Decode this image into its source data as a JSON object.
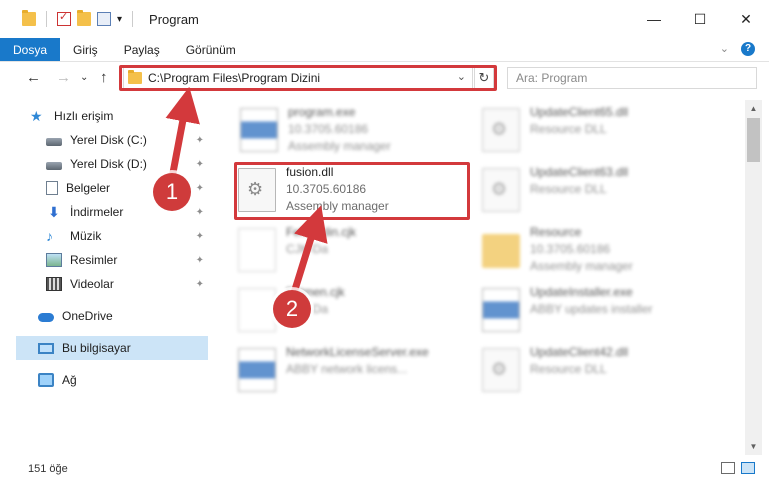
{
  "window": {
    "title": "Program",
    "buttons": {
      "minimize": "—",
      "maximize": "☐",
      "close": "✕"
    }
  },
  "ribbon": {
    "tabs": [
      "Dosya",
      "Giriş",
      "Paylaş",
      "Görünüm"
    ],
    "expand": "⌄",
    "help": "?"
  },
  "nav": {
    "back": "←",
    "forward": "→",
    "recent": "⌄",
    "up": "↑",
    "address": "C:\\Program Files\\Program Dizini",
    "address_chevron": "⌄",
    "refresh": "↻",
    "search_placeholder": "Ara: Program"
  },
  "sidebar": {
    "items": [
      {
        "label": "Hızlı erişim",
        "icon": "star-icon"
      },
      {
        "label": "Yerel Disk (C:)",
        "icon": "drive-icon",
        "pinned": true
      },
      {
        "label": "Yerel Disk (D:)",
        "icon": "drive-icon",
        "pinned": true
      },
      {
        "label": "Belgeler",
        "icon": "document-icon",
        "pinned": true
      },
      {
        "label": "İndirmeler",
        "icon": "download-icon",
        "pinned": true
      },
      {
        "label": "Müzik",
        "icon": "music-icon",
        "pinned": true
      },
      {
        "label": "Resimler",
        "icon": "pictures-icon",
        "pinned": true
      },
      {
        "label": "Videolar",
        "icon": "videos-icon",
        "pinned": true
      },
      {
        "label": "OneDrive",
        "icon": "cloud-icon"
      },
      {
        "label": "Bu bilgisayar",
        "icon": "computer-icon",
        "selected": true
      },
      {
        "label": "Ağ",
        "icon": "network-icon"
      }
    ],
    "pin_glyph": "📌"
  },
  "files": [
    {
      "name": "program.exe",
      "line2": "10.3705.60186",
      "line3": "Assembly manager",
      "icon": "exe-icon",
      "blurred": true
    },
    {
      "name": "UpdateClient65.dll",
      "line2": "Resource DLL",
      "line3": "",
      "icon": "dll-icon",
      "blurred": true
    },
    {
      "name": "fusion.dll",
      "line2": "10.3705.60186",
      "line3": "Assembly manager",
      "icon": "dll-icon",
      "blurred": false
    },
    {
      "name": "UpdateClient63.dll",
      "line2": "Resource DLL",
      "line3": "",
      "icon": "dll-icon",
      "blurred": true
    },
    {
      "name": "Fehlerklin.cjk",
      "line2": "CJK-Da",
      "line3": "",
      "icon": "file-icon",
      "blurred": true
    },
    {
      "name": "Resource",
      "line2": "10.3705.60186",
      "line3": "Assembly manager",
      "icon": "folder-icon",
      "blurred": true
    },
    {
      "name": "Fatmen.cjk",
      "line2": "CJK-Da",
      "line3": "",
      "icon": "file-icon",
      "blurred": true
    },
    {
      "name": "UpdateInstaller.exe",
      "line2": "ABBY updates installer",
      "line3": "",
      "icon": "exe-icon",
      "blurred": true
    },
    {
      "name": "NetworkLicenseServer.exe",
      "line2": "ABBY network licens...",
      "line3": "",
      "icon": "exe-icon",
      "blurred": true
    },
    {
      "name": "UpdateClient42.dll",
      "line2": "Resource DLL",
      "line3": "",
      "icon": "dll-icon",
      "blurred": true
    }
  ],
  "status": {
    "count": "151 öğe"
  },
  "annotations": {
    "step1": "1",
    "step2": "2",
    "accent": "#d3393c"
  }
}
